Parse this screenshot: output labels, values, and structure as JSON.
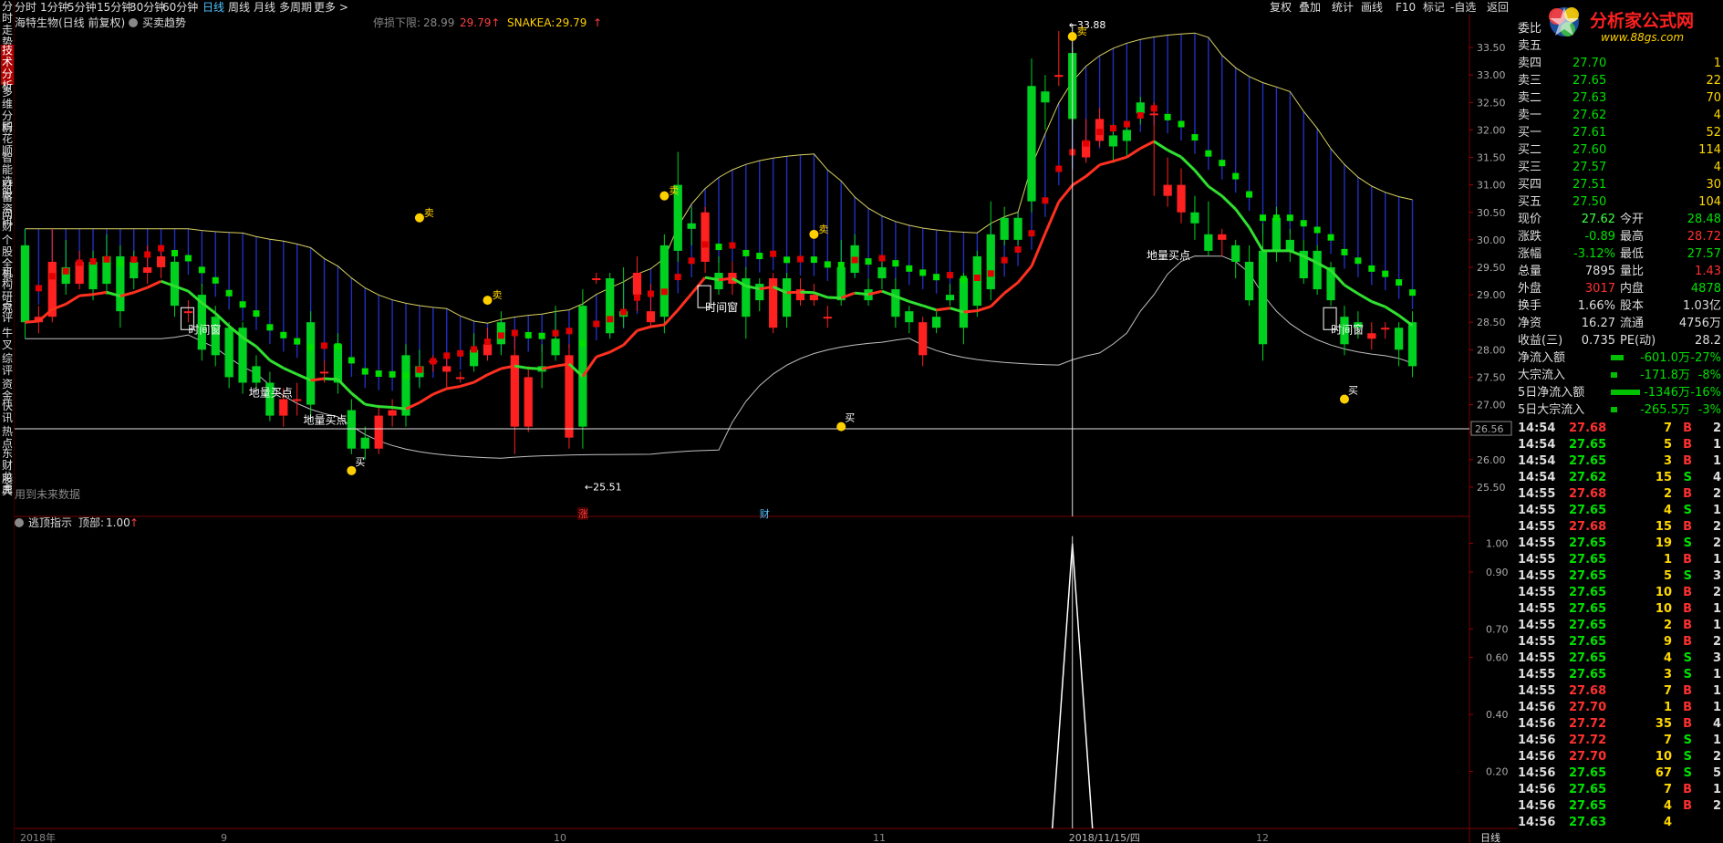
{
  "sidebar": [
    "分时走势",
    "技术分析",
    "多维分析",
    "同花顺",
    "智能选股",
    "财富资讯",
    "问财",
    "个股全景",
    "机构研究",
    "点评",
    "牛叉",
    "综评",
    "资金",
    "快讯",
    "热点",
    "东财龙虎",
    "股典"
  ],
  "topbar": {
    "periods": [
      "分时",
      "1分钟",
      "5分钟",
      "15分钟",
      "30分钟",
      "60分钟",
      "日线",
      "周线",
      "月线",
      "多周期",
      "更多 >"
    ],
    "active_period": "日线",
    "right": [
      "复权",
      "叠加",
      "统计",
      "画线",
      "F10",
      "标记",
      "-自选",
      "返回"
    ]
  },
  "header": {
    "stock": "海特生物(日线 前复权)",
    "indicator": "买卖趋势",
    "stop_label": "停损下限:",
    "stop_val1": "28.99",
    "stop_val2": "29.79",
    "snake_label": "SNAKEA:",
    "snake_val": "29.79"
  },
  "lower_header": {
    "name": "逃顶指示",
    "label": "顶部:",
    "value": "1.00"
  },
  "no_future": "用到未来数据",
  "annotations": {
    "high": "33.88",
    "low": "25.51",
    "buy": "买",
    "sell": "卖",
    "dibao": "地量买点",
    "window": "时间窗",
    "zhang": "涨",
    "cai": "财"
  },
  "crosshair": {
    "value": "26.56",
    "date": "2018/11/15/四"
  },
  "x_labels": [
    "2018年",
    "9",
    "10",
    "11",
    "12"
  ],
  "x_label_last": "日线",
  "chart_data": {
    "type": "candlestick",
    "y_upper": {
      "range": [
        25.0,
        33.8
      ],
      "ticks": [
        "33.50",
        "33.00",
        "32.50",
        "32.00",
        "31.50",
        "31.00",
        "30.50",
        "30.00",
        "29.50",
        "29.00",
        "28.50",
        "28.00",
        "27.50",
        "27.00",
        "26.50",
        "26.00",
        "25.50"
      ]
    },
    "y_lower": {
      "range": [
        0,
        1.05
      ],
      "ticks": [
        "1.00",
        "0.90",
        "0.70",
        "0.60",
        "0.40",
        "0.20"
      ]
    },
    "candles": [
      {
        "o": 29.9,
        "c": 28.5,
        "h": 30.2,
        "l": 28.2
      },
      {
        "o": 28.5,
        "c": 28.6,
        "h": 28.8,
        "l": 28.3
      },
      {
        "o": 28.6,
        "c": 29.6,
        "h": 30.2,
        "l": 28.5
      },
      {
        "o": 29.5,
        "c": 29.2,
        "h": 30.0,
        "l": 29.0
      },
      {
        "o": 29.2,
        "c": 29.6,
        "h": 29.8,
        "l": 29.1
      },
      {
        "o": 29.6,
        "c": 29.1,
        "h": 29.8,
        "l": 28.9
      },
      {
        "o": 29.7,
        "c": 29.2,
        "h": 30.1,
        "l": 29.0
      },
      {
        "o": 29.7,
        "c": 28.7,
        "h": 29.9,
        "l": 28.4
      },
      {
        "o": 29.6,
        "c": 29.3,
        "h": 29.8,
        "l": 29.1
      },
      {
        "o": 29.4,
        "c": 29.5,
        "h": 29.9,
        "l": 29.2
      },
      {
        "o": 29.5,
        "c": 29.7,
        "h": 29.8,
        "l": 29.3
      },
      {
        "o": 29.6,
        "c": 28.8,
        "h": 29.7,
        "l": 28.6
      },
      {
        "o": 28.7,
        "c": 28.7,
        "h": 28.9,
        "l": 28.5
      },
      {
        "o": 29.0,
        "c": 28.0,
        "h": 29.2,
        "l": 27.8
      },
      {
        "o": 28.6,
        "c": 27.9,
        "h": 28.8,
        "l": 27.7
      },
      {
        "o": 28.4,
        "c": 27.5,
        "h": 28.5,
        "l": 27.3
      },
      {
        "o": 28.4,
        "c": 27.4,
        "h": 28.5,
        "l": 27.2
      },
      {
        "o": 27.7,
        "c": 27.4,
        "h": 27.9,
        "l": 27.3
      },
      {
        "o": 27.4,
        "c": 26.8,
        "h": 27.6,
        "l": 26.7
      },
      {
        "o": 26.8,
        "c": 27.1,
        "h": 27.3,
        "l": 26.6
      },
      {
        "o": 27.1,
        "c": 27.1,
        "h": 27.4,
        "l": 26.8
      },
      {
        "o": 28.5,
        "c": 27.0,
        "h": 28.7,
        "l": 26.7
      },
      {
        "o": 27.6,
        "c": 27.6,
        "h": 27.8,
        "l": 27.4
      },
      {
        "o": 28.1,
        "c": 27.4,
        "h": 28.3,
        "l": 27.2
      },
      {
        "o": 26.9,
        "c": 26.2,
        "h": 27.1,
        "l": 26.1
      },
      {
        "o": 26.4,
        "c": 26.2,
        "h": 26.6,
        "l": 26.0
      },
      {
        "o": 26.2,
        "c": 26.8,
        "h": 27.0,
        "l": 26.1
      },
      {
        "o": 26.8,
        "c": 26.9,
        "h": 27.1,
        "l": 26.6
      },
      {
        "o": 27.9,
        "c": 26.8,
        "h": 28.1,
        "l": 26.6
      },
      {
        "o": 27.7,
        "c": 27.5,
        "h": 28.0,
        "l": 27.3
      },
      {
        "o": 27.8,
        "c": 27.8,
        "h": 27.9,
        "l": 27.6
      },
      {
        "o": 27.6,
        "c": 27.7,
        "h": 27.9,
        "l": 27.3
      },
      {
        "o": 27.5,
        "c": 27.5,
        "h": 27.6,
        "l": 27.4
      },
      {
        "o": 28.0,
        "c": 27.7,
        "h": 28.3,
        "l": 27.6
      },
      {
        "o": 27.9,
        "c": 28.1,
        "h": 28.4,
        "l": 27.8
      },
      {
        "o": 28.5,
        "c": 28.1,
        "h": 28.7,
        "l": 27.9
      },
      {
        "o": 26.6,
        "c": 27.9,
        "h": 28.3,
        "l": 26.1
      },
      {
        "o": 26.6,
        "c": 27.5,
        "h": 27.7,
        "l": 26.5
      },
      {
        "o": 27.7,
        "c": 27.6,
        "h": 28.1,
        "l": 27.3
      },
      {
        "o": 28.2,
        "c": 27.9,
        "h": 28.8,
        "l": 27.8
      },
      {
        "o": 26.4,
        "c": 27.9,
        "h": 28.1,
        "l": 26.2
      },
      {
        "o": 28.8,
        "c": 26.6,
        "h": 29.1,
        "l": 26.2
      },
      {
        "o": 29.3,
        "c": 29.3,
        "h": 29.4,
        "l": 29.2
      },
      {
        "o": 29.3,
        "c": 28.3,
        "h": 29.4,
        "l": 28.2
      },
      {
        "o": 28.7,
        "c": 28.6,
        "h": 29.5,
        "l": 28.4
      },
      {
        "o": 29.0,
        "c": 29.4,
        "h": 29.7,
        "l": 28.7
      },
      {
        "o": 28.5,
        "c": 28.7,
        "h": 29.2,
        "l": 28.4
      },
      {
        "o": 29.9,
        "c": 28.6,
        "h": 30.1,
        "l": 28.3
      },
      {
        "o": 31.0,
        "c": 29.8,
        "h": 31.6,
        "l": 29.6
      },
      {
        "o": 30.3,
        "c": 30.2,
        "h": 30.6,
        "l": 29.9
      },
      {
        "o": 29.6,
        "c": 30.5,
        "h": 30.6,
        "l": 29.4
      },
      {
        "o": 29.4,
        "c": 29.1,
        "h": 29.7,
        "l": 29.0
      },
      {
        "o": 29.2,
        "c": 29.4,
        "h": 29.6,
        "l": 29.0
      },
      {
        "o": 29.3,
        "c": 28.6,
        "h": 29.5,
        "l": 28.2
      },
      {
        "o": 29.2,
        "c": 28.9,
        "h": 29.3,
        "l": 28.7
      },
      {
        "o": 28.4,
        "c": 29.3,
        "h": 29.4,
        "l": 28.3
      },
      {
        "o": 29.3,
        "c": 28.6,
        "h": 29.4,
        "l": 28.4
      },
      {
        "o": 28.9,
        "c": 29.1,
        "h": 29.3,
        "l": 28.8
      },
      {
        "o": 28.9,
        "c": 29.0,
        "h": 29.2,
        "l": 28.8
      },
      {
        "o": 28.6,
        "c": 28.6,
        "h": 28.8,
        "l": 28.4
      },
      {
        "o": 29.5,
        "c": 28.9,
        "h": 30.0,
        "l": 28.8
      },
      {
        "o": 29.9,
        "c": 29.4,
        "h": 30.1,
        "l": 29.3
      },
      {
        "o": 29.1,
        "c": 28.9,
        "h": 29.3,
        "l": 28.8
      },
      {
        "o": 29.5,
        "c": 29.3,
        "h": 29.6,
        "l": 29.1
      },
      {
        "o": 29.1,
        "c": 28.6,
        "h": 29.3,
        "l": 28.4
      },
      {
        "o": 28.7,
        "c": 28.5,
        "h": 28.8,
        "l": 28.3
      },
      {
        "o": 27.9,
        "c": 28.5,
        "h": 28.6,
        "l": 27.7
      },
      {
        "o": 28.6,
        "c": 28.4,
        "h": 28.7,
        "l": 28.3
      },
      {
        "o": 29.0,
        "c": 28.9,
        "h": 29.2,
        "l": 28.8
      },
      {
        "o": 29.3,
        "c": 28.4,
        "h": 29.4,
        "l": 28.1
      },
      {
        "o": 29.7,
        "c": 28.8,
        "h": 29.8,
        "l": 28.6
      },
      {
        "o": 30.1,
        "c": 29.1,
        "h": 30.7,
        "l": 28.9
      },
      {
        "o": 30.4,
        "c": 30.0,
        "h": 30.6,
        "l": 29.9
      },
      {
        "o": 30.4,
        "c": 30.0,
        "h": 30.5,
        "l": 29.9
      },
      {
        "o": 32.8,
        "c": 30.7,
        "h": 33.3,
        "l": 30.5
      },
      {
        "o": 32.7,
        "c": 32.5,
        "h": 33.0,
        "l": 32.0
      },
      {
        "o": 33.0,
        "c": 33.0,
        "h": 33.8,
        "l": 32.8
      },
      {
        "o": 33.4,
        "c": 32.2,
        "h": 33.5,
        "l": 32.1
      },
      {
        "o": 31.5,
        "c": 31.8,
        "h": 32.2,
        "l": 31.4
      },
      {
        "o": 31.8,
        "c": 32.2,
        "h": 32.4,
        "l": 31.7
      },
      {
        "o": 31.9,
        "c": 31.7,
        "h": 32.1,
        "l": 31.4
      },
      {
        "o": 32.0,
        "c": 31.8,
        "h": 32.1,
        "l": 31.5
      },
      {
        "o": 32.5,
        "c": 32.3,
        "h": 32.6,
        "l": 32.1
      },
      {
        "o": 32.3,
        "c": 32.3,
        "h": 32.5,
        "l": 30.8
      },
      {
        "o": 30.8,
        "c": 31.0,
        "h": 31.5,
        "l": 30.6
      },
      {
        "o": 30.5,
        "c": 31.0,
        "h": 31.3,
        "l": 30.3
      },
      {
        "o": 30.5,
        "c": 30.3,
        "h": 30.8,
        "l": 30.0
      },
      {
        "o": 30.1,
        "c": 29.8,
        "h": 30.7,
        "l": 29.7
      },
      {
        "o": 30.0,
        "c": 30.1,
        "h": 30.2,
        "l": 29.7
      },
      {
        "o": 29.9,
        "c": 29.6,
        "h": 30.0,
        "l": 29.3
      },
      {
        "o": 29.6,
        "c": 28.9,
        "h": 29.9,
        "l": 28.8
      },
      {
        "o": 29.8,
        "c": 28.1,
        "h": 30.3,
        "l": 27.8
      },
      {
        "o": 30.4,
        "c": 29.8,
        "h": 30.6,
        "l": 29.6
      },
      {
        "o": 30.0,
        "c": 29.8,
        "h": 30.2,
        "l": 29.6
      },
      {
        "o": 29.8,
        "c": 29.3,
        "h": 30.0,
        "l": 29.2
      },
      {
        "o": 29.8,
        "c": 29.1,
        "h": 29.9,
        "l": 29.0
      },
      {
        "o": 29.5,
        "c": 28.9,
        "h": 29.6,
        "l": 28.8
      },
      {
        "o": 28.6,
        "c": 28.1,
        "h": 28.8,
        "l": 27.9
      },
      {
        "o": 28.5,
        "c": 28.4,
        "h": 28.7,
        "l": 28.2
      },
      {
        "o": 28.2,
        "c": 28.3,
        "h": 28.5,
        "l": 28.0
      },
      {
        "o": 28.4,
        "c": 28.4,
        "h": 28.5,
        "l": 28.2
      },
      {
        "o": 28.4,
        "c": 28.0,
        "h": 28.5,
        "l": 27.7
      },
      {
        "o": 28.5,
        "c": 27.7,
        "h": 28.7,
        "l": 27.5
      }
    ],
    "crosshair_index": 77,
    "spike_index": 77
  },
  "panel": {
    "weibi": "委比",
    "orders": [
      {
        "label": "卖五",
        "price": "",
        "vol": ""
      },
      {
        "label": "卖四",
        "price": "27.70",
        "vol": "1"
      },
      {
        "label": "卖三",
        "price": "27.65",
        "vol": "22"
      },
      {
        "label": "卖二",
        "price": "27.63",
        "vol": "70"
      },
      {
        "label": "卖一",
        "price": "27.62",
        "vol": "4"
      },
      {
        "label": "买一",
        "price": "27.61",
        "vol": "52"
      },
      {
        "label": "买二",
        "price": "27.60",
        "vol": "114"
      },
      {
        "label": "买三",
        "price": "27.57",
        "vol": "4"
      },
      {
        "label": "买四",
        "price": "27.51",
        "vol": "30"
      },
      {
        "label": "买五",
        "price": "27.50",
        "vol": "104"
      }
    ],
    "stats": [
      [
        "现价",
        "27.62",
        "今开",
        "28.48"
      ],
      [
        "涨跌",
        "-0.89",
        "最高",
        "28.72"
      ],
      [
        "涨幅",
        "-3.12%",
        "最低",
        "27.57"
      ],
      [
        "总量",
        "7895",
        "量比",
        "1.43"
      ],
      [
        "外盘",
        "3017",
        "内盘",
        "4878"
      ],
      [
        "换手",
        "1.66%",
        "股本",
        "1.03亿"
      ],
      [
        "净资",
        "16.27",
        "流通",
        "4756万"
      ],
      [
        "收益(三)",
        "0.735",
        "PE(动)",
        "28.2"
      ]
    ],
    "flows": [
      {
        "label": "净流入额",
        "val": "-601.0万",
        "pct": "-27%",
        "bar": 0.35
      },
      {
        "label": "大宗流入",
        "val": "-171.8万",
        "pct": "-8%",
        "bar": 0.1
      },
      {
        "label": "5日净流入额",
        "val": "-1346万",
        "pct": "-16%",
        "bar": 1.0
      },
      {
        "label": "5日大宗流入",
        "val": "-265.5万",
        "pct": "-3%",
        "bar": 0.1
      }
    ],
    "ticks": [
      [
        "14:54",
        "27.68",
        "7",
        "B",
        "2"
      ],
      [
        "14:54",
        "27.65",
        "5",
        "B",
        "1"
      ],
      [
        "14:54",
        "27.65",
        "3",
        "B",
        "1"
      ],
      [
        "14:54",
        "27.62",
        "15",
        "S",
        "4"
      ],
      [
        "14:55",
        "27.68",
        "2",
        "B",
        "2"
      ],
      [
        "14:55",
        "27.65",
        "4",
        "S",
        "1"
      ],
      [
        "14:55",
        "27.68",
        "15",
        "B",
        "2"
      ],
      [
        "14:55",
        "27.65",
        "19",
        "S",
        "2"
      ],
      [
        "14:55",
        "27.65",
        "1",
        "B",
        "1"
      ],
      [
        "14:55",
        "27.65",
        "5",
        "S",
        "3"
      ],
      [
        "14:55",
        "27.65",
        "10",
        "B",
        "2"
      ],
      [
        "14:55",
        "27.65",
        "10",
        "B",
        "1"
      ],
      [
        "14:55",
        "27.65",
        "2",
        "B",
        "1"
      ],
      [
        "14:55",
        "27.65",
        "9",
        "B",
        "2"
      ],
      [
        "14:55",
        "27.65",
        "4",
        "S",
        "3"
      ],
      [
        "14:55",
        "27.65",
        "3",
        "S",
        "1"
      ],
      [
        "14:55",
        "27.68",
        "7",
        "B",
        "1"
      ],
      [
        "14:56",
        "27.70",
        "1",
        "B",
        "1"
      ],
      [
        "14:56",
        "27.72",
        "35",
        "B",
        "4"
      ],
      [
        "14:56",
        "27.72",
        "7",
        "S",
        "1"
      ],
      [
        "14:56",
        "27.70",
        "10",
        "S",
        "2"
      ],
      [
        "14:56",
        "27.65",
        "67",
        "S",
        "5"
      ],
      [
        "14:56",
        "27.65",
        "7",
        "B",
        "1"
      ],
      [
        "14:56",
        "27.65",
        "4",
        "B",
        "2"
      ],
      [
        "14:56",
        "27.63",
        "4",
        "",
        " "
      ]
    ]
  },
  "logo": {
    "title": "分析家公式网",
    "url": "www.88gs.com"
  }
}
